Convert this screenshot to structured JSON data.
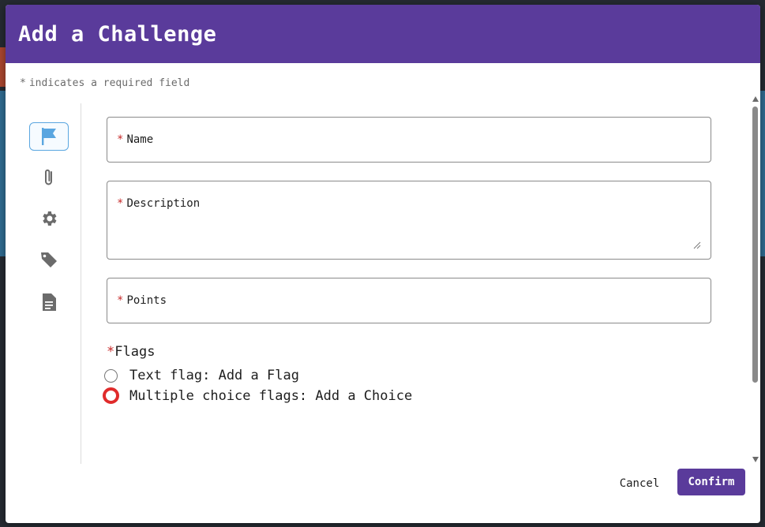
{
  "dialog": {
    "title": "Add a Challenge",
    "required_note": "indicates a required field",
    "required_marker": "*"
  },
  "side_nav": {
    "items": [
      {
        "icon": "flag-icon",
        "active": true
      },
      {
        "icon": "paperclip-icon",
        "active": false
      },
      {
        "icon": "gear-icon",
        "active": false
      },
      {
        "icon": "tag-icon",
        "active": false
      },
      {
        "icon": "document-icon",
        "active": false
      }
    ]
  },
  "form": {
    "name_label": "Name",
    "name_value": "",
    "description_label": "Description",
    "description_value": "",
    "points_label": "Points",
    "points_value": ""
  },
  "flags": {
    "title": "Flags",
    "options": [
      {
        "label": "Text flag: Add a Flag",
        "selected": false
      },
      {
        "label": "Multiple choice flags: Add a Choice",
        "selected": false,
        "focused": true
      }
    ]
  },
  "actions": {
    "cancel_label": "Cancel",
    "confirm_label": "Confirm"
  },
  "colors": {
    "header": "#5a3b9b",
    "accent": "#5a3b9b",
    "required": "#c62828",
    "focus_ring": "#e02b2b",
    "active_nav_border": "#5aa6e0",
    "active_flag": "#5aa6e0"
  }
}
